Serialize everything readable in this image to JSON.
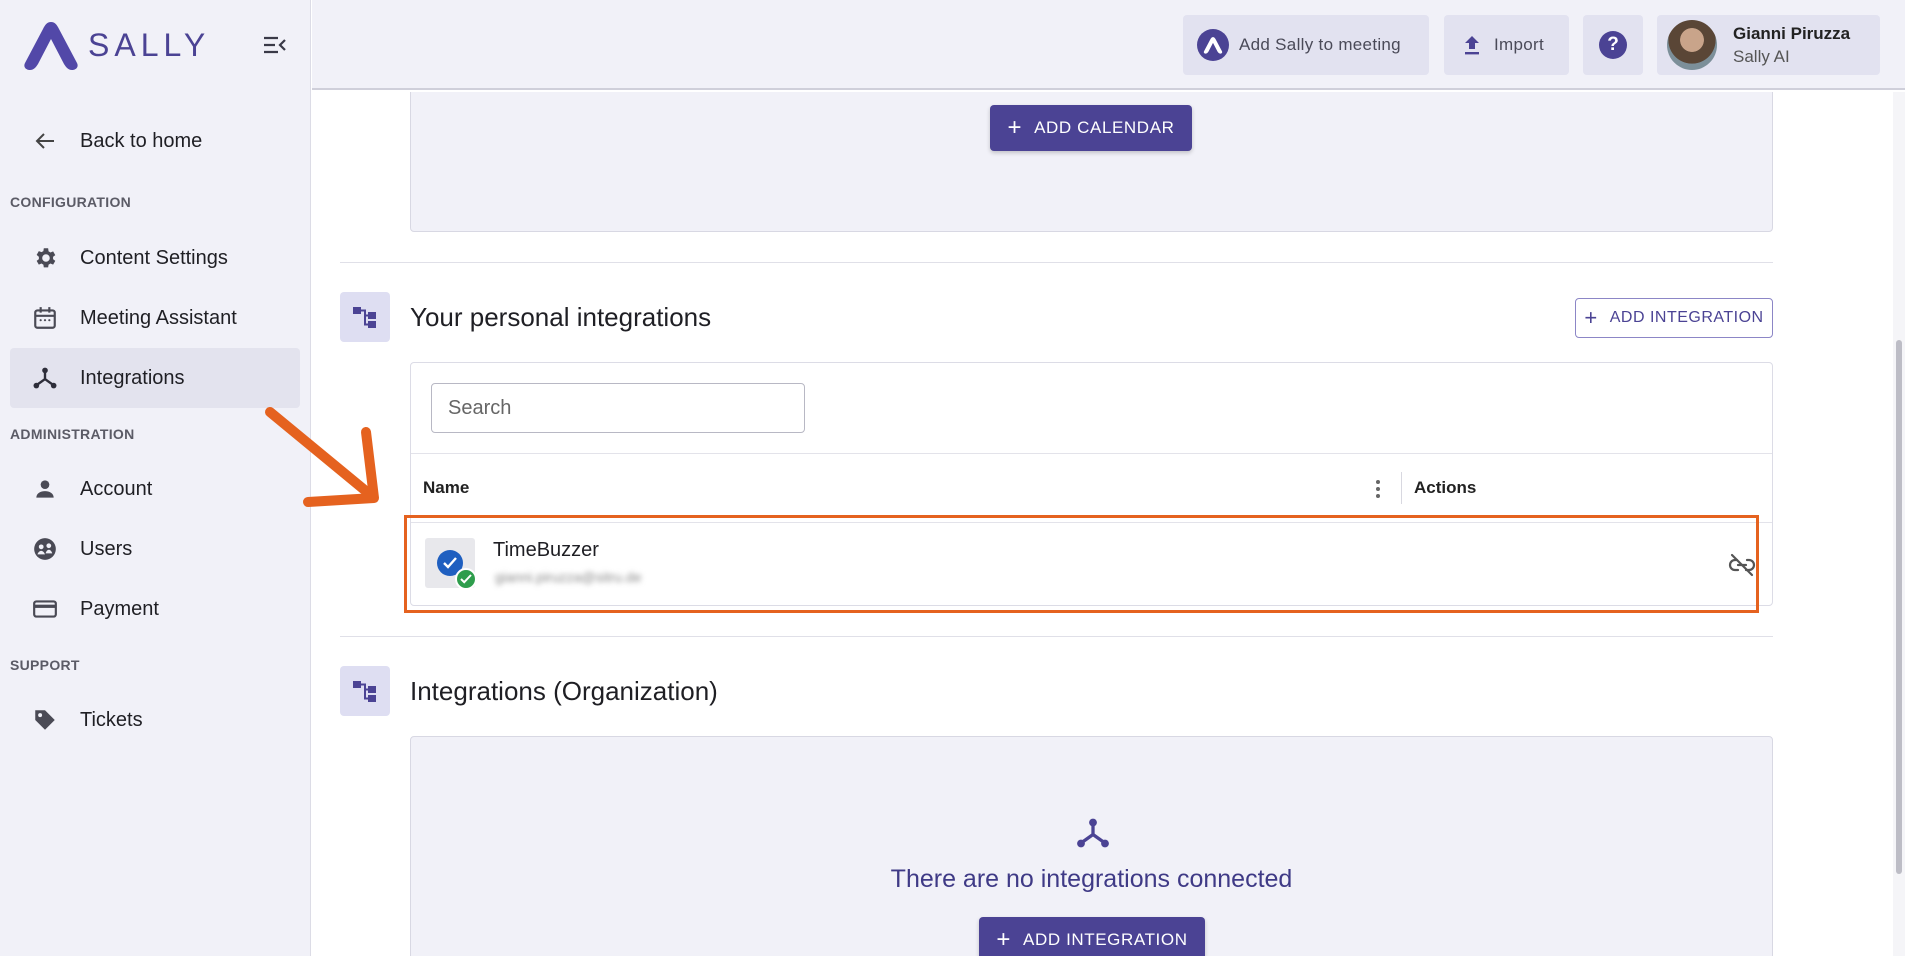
{
  "brand": {
    "name": "SALLY"
  },
  "sidebar": {
    "back_label": "Back to home",
    "sections": {
      "configuration": "CONFIGURATION",
      "administration": "ADMINISTRATION",
      "support": "SUPPORT"
    },
    "items": {
      "content_settings": "Content Settings",
      "meeting_assistant": "Meeting Assistant",
      "integrations": "Integrations",
      "account": "Account",
      "users": "Users",
      "payment": "Payment",
      "tickets": "Tickets"
    },
    "active_item": "Integrations"
  },
  "topbar": {
    "add_sally_label": "Add Sally to meeting",
    "import_label": "Import",
    "help_icon": "question-icon",
    "user": {
      "name": "Gianni Piruzza",
      "org": "Sally AI"
    }
  },
  "calendar": {
    "add_calendar_label": "ADD CALENDAR"
  },
  "personal_integrations": {
    "title": "Your personal integrations",
    "add_label": "ADD INTEGRATION",
    "search_placeholder": "Search",
    "columns": {
      "name": "Name",
      "actions": "Actions"
    },
    "rows": [
      {
        "name": "TimeBuzzer",
        "email": "gianni.piruzza@sitru.de",
        "status": "connected",
        "action_icon": "unlink-icon"
      }
    ]
  },
  "org_integrations": {
    "title": "Integrations (Organization)",
    "empty_message": "There are no integrations connected",
    "add_label": "ADD INTEGRATION"
  },
  "colors": {
    "accent": "#4b4394",
    "sidebar_bg": "#f1f1f8",
    "highlight": "#e5621f",
    "success": "#2e9d4c"
  }
}
